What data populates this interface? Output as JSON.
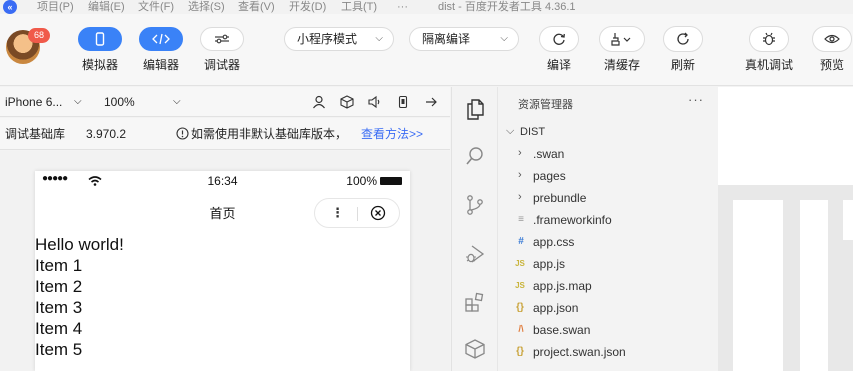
{
  "menubar": {
    "items": [
      "项目(P)",
      "编辑(E)",
      "文件(F)",
      "选择(S)",
      "查看(V)",
      "开发(D)",
      "工具(T)",
      "···"
    ],
    "window_title": "dist - 百度开发者工具 4.36.1"
  },
  "toolbar": {
    "badge_count": "68",
    "simulator_label": "模拟器",
    "editor_label": "编辑器",
    "debugger_label": "调试器",
    "mode_select": "小程序模式",
    "compile_select": "隔离编译",
    "compile_label": "编译",
    "clear_cache_label": "清缓存",
    "refresh_label": "刷新",
    "remote_debug_label": "真机调试",
    "preview_label": "预览"
  },
  "device_bar": {
    "device": "iPhone 6...",
    "zoom": "100%"
  },
  "lib_bar": {
    "label": "调试基础库",
    "version": "3.970.2",
    "notice": "如需使用非默认基础库版本，",
    "help_link": "查看方法>>"
  },
  "phone": {
    "signal": "●●●●●",
    "time": "16:34",
    "battery_text": "100%",
    "nav_title": "首页",
    "lines": [
      "Hello world!",
      "Item 1",
      "Item 2",
      "Item 3",
      "Item 4",
      "Item 5"
    ]
  },
  "explorer": {
    "header": "资源管理器",
    "more": "···",
    "root": "DIST",
    "items": [
      {
        "name": ".swan",
        "kind": "folder"
      },
      {
        "name": "pages",
        "kind": "folder"
      },
      {
        "name": "prebundle",
        "kind": "folder"
      },
      {
        "name": ".frameworkinfo",
        "kind": "file"
      },
      {
        "name": "app.css",
        "kind": "css"
      },
      {
        "name": "app.js",
        "kind": "js"
      },
      {
        "name": "app.js.map",
        "kind": "js"
      },
      {
        "name": "app.json",
        "kind": "json"
      },
      {
        "name": "base.swan",
        "kind": "swan"
      },
      {
        "name": "project.swan.json",
        "kind": "json"
      }
    ]
  },
  "colors": {
    "accent": "#3a82f7",
    "badge": "#f05a4a",
    "link": "#3a6cf4",
    "js_icon": "#c9b43a",
    "css_icon": "#3a7bd5",
    "json_icon": "#c9a33a",
    "swan_icon": "#e07a3a"
  }
}
